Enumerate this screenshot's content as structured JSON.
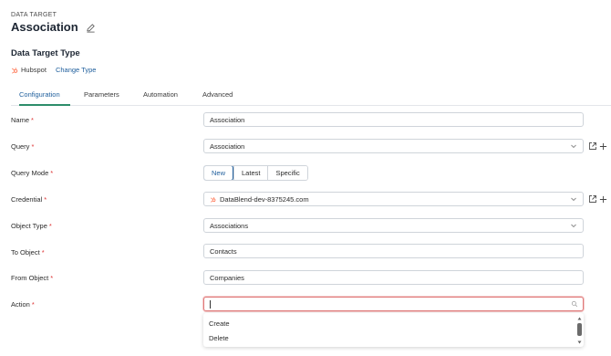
{
  "header": {
    "overline": "DATA TARGET",
    "title": "Association"
  },
  "target_type": {
    "section_title": "Data Target Type",
    "type_name": "Hubspot",
    "change_link": "Change Type"
  },
  "tabs": [
    {
      "label": "Configuration",
      "active": true
    },
    {
      "label": "Parameters",
      "active": false
    },
    {
      "label": "Automation",
      "active": false
    },
    {
      "label": "Advanced",
      "active": false
    }
  ],
  "form": {
    "name": {
      "label": "Name",
      "value": "Association"
    },
    "query": {
      "label": "Query",
      "value": "Association"
    },
    "query_mode": {
      "label": "Query Mode",
      "options": [
        "New",
        "Latest",
        "Specific"
      ],
      "selected": "New"
    },
    "credential": {
      "label": "Credential",
      "value": "DataBlend-dev-8375245.com"
    },
    "object_type": {
      "label": "Object Type",
      "value": "Associations"
    },
    "to_object": {
      "label": "To Object",
      "value": "Contacts"
    },
    "from_object": {
      "label": "From Object",
      "value": "Companies"
    },
    "action": {
      "label": "Action",
      "value": "",
      "options": [
        "Create",
        "Delete"
      ]
    }
  },
  "required_mark": "*",
  "colors": {
    "accent": "#1e5e9c",
    "tab_underline": "#2d8d6a",
    "required": "#dd3333",
    "hubspot": "#ff7a59",
    "error_border": "#e07a7a"
  },
  "icons": {
    "edit": "pencil-icon",
    "hubspot": "hubspot-icon",
    "chevron": "chevron-down-icon",
    "open": "external-link-icon",
    "add": "plus-icon",
    "search": "search-icon"
  }
}
